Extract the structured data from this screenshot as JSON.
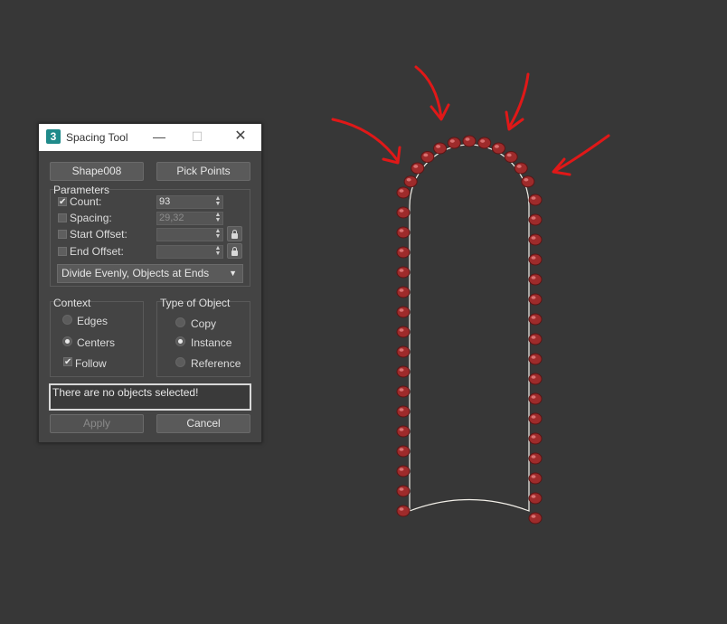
{
  "viewport": {
    "shape_fill": "#373737",
    "shape_stroke": "#f4f1ea",
    "bead_color": "#9e2b2b",
    "arrow_color": "#e01818"
  },
  "dialog": {
    "title": "Spacing Tool",
    "app_icon_label": "3",
    "pick_path_label": "Shape008",
    "pick_points_label": "Pick Points",
    "parameters": {
      "title": "Parameters",
      "count": {
        "label": "Count:",
        "checked": true,
        "value": "93"
      },
      "spacing": {
        "label": "Spacing:",
        "checked": false,
        "value": "29,32"
      },
      "start_offset": {
        "label": "Start Offset:",
        "checked": false,
        "value": ""
      },
      "end_offset": {
        "label": "End Offset:",
        "checked": false,
        "value": ""
      },
      "distribution": "Divide Evenly, Objects at Ends"
    },
    "context": {
      "title": "Context",
      "edges": "Edges",
      "centers": "Centers",
      "follow": "Follow"
    },
    "type_of_object": {
      "title": "Type of Object",
      "copy": "Copy",
      "instance": "Instance",
      "reference": "Reference"
    },
    "status_text": "There are no objects selected!",
    "apply_label": "Apply",
    "cancel_label": "Cancel"
  }
}
